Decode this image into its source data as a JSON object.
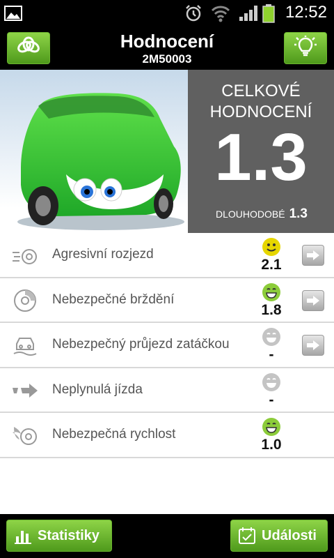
{
  "status_bar": {
    "time": "12:52"
  },
  "header": {
    "title": "Hodnocení",
    "subtitle": "2M50003"
  },
  "overall": {
    "label_line1": "CELKOVÉ",
    "label_line2": "HODNOCENÍ",
    "score": "1.3",
    "longterm_label": "DLOUHODOBÉ",
    "longterm_score": "1.3"
  },
  "items": [
    {
      "label": "Agresivní rozjezd",
      "score": "2.1",
      "face": "yellow-smiley-icon",
      "face_color": "#e6d600",
      "has_arrow": true
    },
    {
      "label": "Nebezpečné brždění",
      "score": "1.8",
      "face": "green-smiley-icon",
      "face_color": "#8ccc3a",
      "has_arrow": true
    },
    {
      "label": "Nebezpečný průjezd zatáčkou",
      "score": "-",
      "face": "gray-smiley-icon",
      "face_color": "#c4c4c4",
      "has_arrow": true
    },
    {
      "label": "Neplynulá jízda",
      "score": "-",
      "face": "gray-smiley-icon",
      "face_color": "#c4c4c4",
      "has_arrow": false
    },
    {
      "label": "Nebezpečná rychlost",
      "score": "1.0",
      "face": "green-smiley-icon",
      "face_color": "#8ccc3a",
      "has_arrow": false
    }
  ],
  "bottom": {
    "stats_label": "Statistiky",
    "events_label": "Události"
  },
  "colors": {
    "accent_green": "#6bb52f",
    "score_panel": "#606060"
  }
}
